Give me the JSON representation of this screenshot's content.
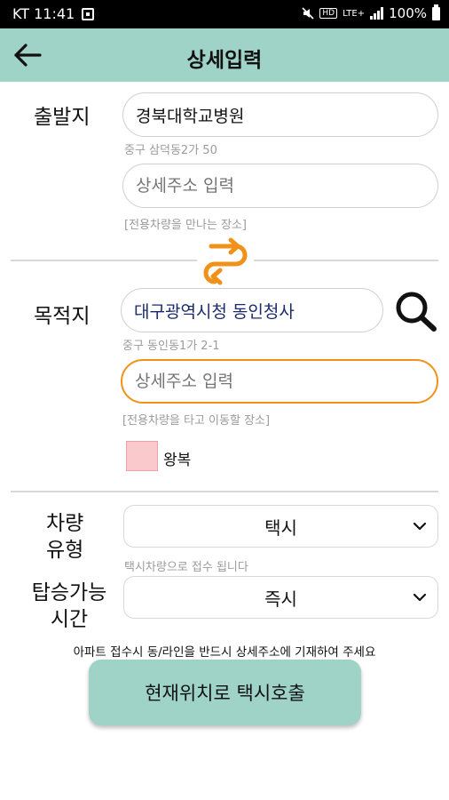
{
  "status_bar": {
    "carrier_time": "KT 11:41",
    "hd": "HD",
    "network": "LTE+",
    "battery": "100%"
  },
  "header": {
    "title": "상세입력",
    "back_icon": "arrow-left-icon"
  },
  "departure": {
    "label": "출발지",
    "place": "경북대학교병원",
    "address": "중구 삼덕동2가 50",
    "detail_placeholder": "상세주소 입력",
    "detail_value": "",
    "hint": "[전용차량을 만나는 장소]"
  },
  "swap_icon": "swap-arrows-icon",
  "destination": {
    "label": "목적지",
    "place": "대구광역시청 동인청사",
    "address": "중구 동인동1가 2-1",
    "detail_placeholder": "상세주소 입력",
    "detail_value": "",
    "hint": "[전용차량을 타고 이동할 장소]",
    "search_icon": "search-icon",
    "round_trip_label": "왕복",
    "round_trip_checked": false
  },
  "vehicle": {
    "label_line1": "차량",
    "label_line2": "유형",
    "selected": "택시",
    "note": "택시차량으로 접수 됩니다"
  },
  "boarding": {
    "label_line1": "탑승가능",
    "label_line2": "시간",
    "selected": "즉시"
  },
  "notice": "아파트 접수시 동/라인을 반드시 상세주소에 기재하여 주세요",
  "call_button": "현재위치로 택시호출",
  "colors": {
    "accent": "#9fd3c7",
    "swap": "#f0921a",
    "focus_border": "#f0921a",
    "checkbox_fill": "#f9c9cc"
  }
}
